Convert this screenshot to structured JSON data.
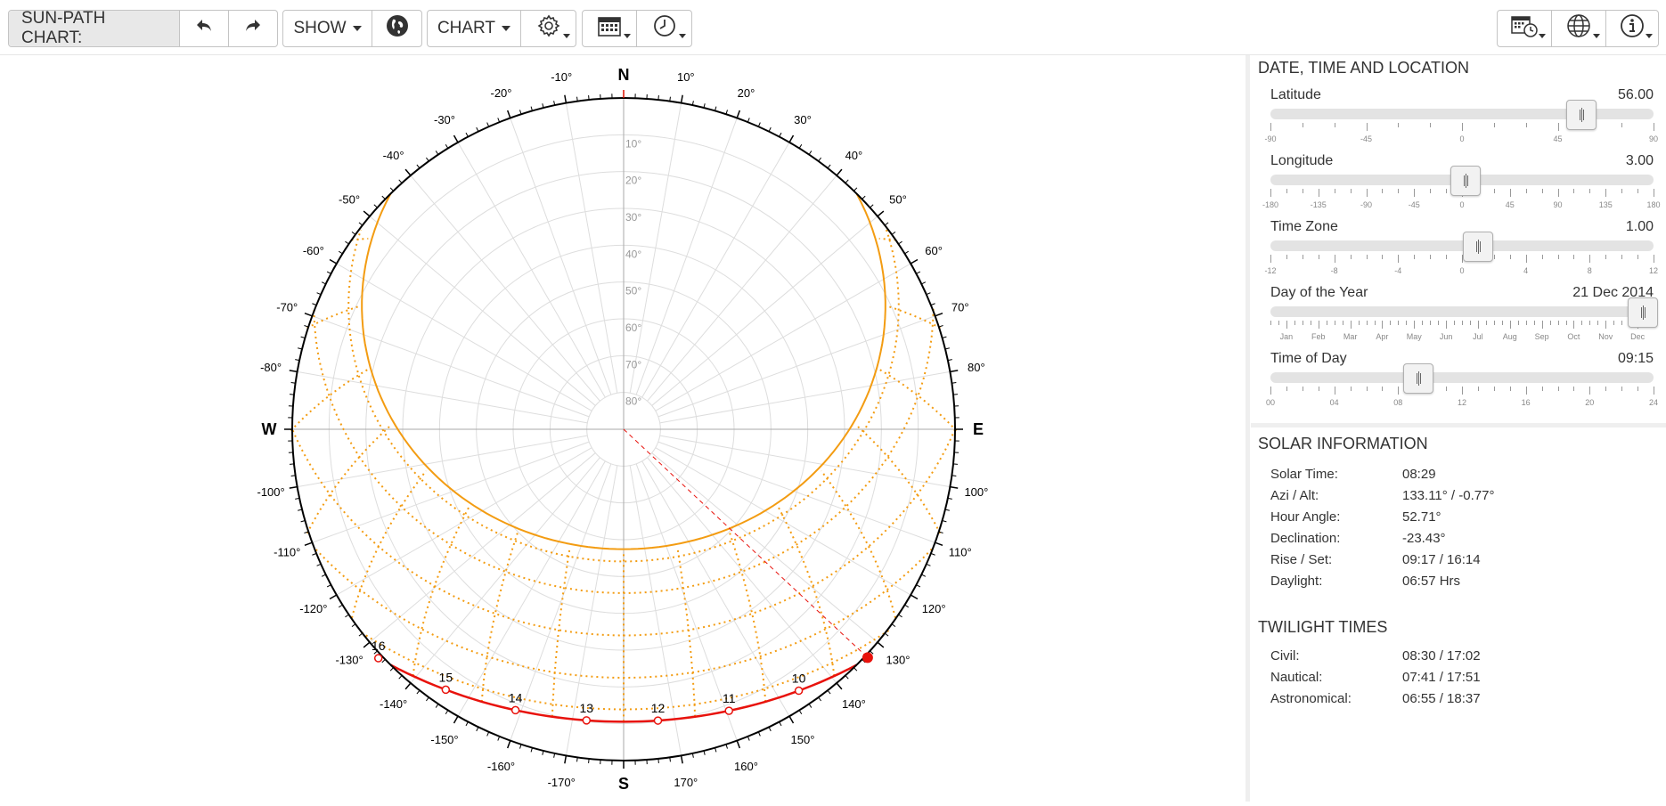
{
  "toolbar": {
    "title": "SUN-PATH CHART:",
    "undo_icon": "undo-icon",
    "redo_icon": "redo-icon",
    "show_label": "SHOW",
    "globe_icon": "globe-icon",
    "chart_label": "CHART",
    "settings_icon": "gear-icon",
    "calendar_icon": "calendar-icon",
    "clock_icon": "clock-icon",
    "date_time_icon": "calendar-clock-icon",
    "location_icon": "globe-outline-icon",
    "info_icon": "info-icon"
  },
  "location": {
    "title": "DATE, TIME AND LOCATION",
    "sliders": [
      {
        "label": "Latitude",
        "value": "56.00",
        "min": -90,
        "max": 90,
        "current": 56,
        "tick_labels": [
          {
            "v": -90,
            "t": "-90"
          },
          {
            "v": -45,
            "t": "-45"
          },
          {
            "v": 0,
            "t": "0"
          },
          {
            "v": 45,
            "t": "45"
          },
          {
            "v": 90,
            "t": "90"
          }
        ],
        "minor_step": 15
      },
      {
        "label": "Longitude",
        "value": "3.00",
        "min": -180,
        "max": 180,
        "current": 3,
        "tick_labels": [
          {
            "v": -180,
            "t": "-180"
          },
          {
            "v": -135,
            "t": "-135"
          },
          {
            "v": -90,
            "t": "-90"
          },
          {
            "v": -45,
            "t": "-45"
          },
          {
            "v": 0,
            "t": "0"
          },
          {
            "v": 45,
            "t": "45"
          },
          {
            "v": 90,
            "t": "90"
          },
          {
            "v": 135,
            "t": "135"
          },
          {
            "v": 180,
            "t": "180"
          }
        ],
        "minor_step": 15
      },
      {
        "label": "Time Zone",
        "value": "1.00",
        "min": -12,
        "max": 12,
        "current": 1,
        "tick_labels": [
          {
            "v": -12,
            "t": "-12"
          },
          {
            "v": -8,
            "t": "-8"
          },
          {
            "v": -4,
            "t": "-4"
          },
          {
            "v": 0,
            "t": "0"
          },
          {
            "v": 4,
            "t": "4"
          },
          {
            "v": 8,
            "t": "8"
          },
          {
            "v": 12,
            "t": "12"
          }
        ],
        "minor_step": 1
      },
      {
        "label": "Day of the Year",
        "value": "21 Dec 2014",
        "min": 0,
        "max": 12,
        "current": 11.67,
        "tick_labels": [
          {
            "v": 0.5,
            "t": "Jan"
          },
          {
            "v": 1.5,
            "t": "Feb"
          },
          {
            "v": 2.5,
            "t": "Mar"
          },
          {
            "v": 3.5,
            "t": "Apr"
          },
          {
            "v": 4.5,
            "t": "May"
          },
          {
            "v": 5.5,
            "t": "Jun"
          },
          {
            "v": 6.5,
            "t": "Jul"
          },
          {
            "v": 7.5,
            "t": "Aug"
          },
          {
            "v": 8.5,
            "t": "Sep"
          },
          {
            "v": 9.5,
            "t": "Oct"
          },
          {
            "v": 10.5,
            "t": "Nov"
          },
          {
            "v": 11.5,
            "t": "Dec"
          }
        ],
        "minor_step": 0.25
      },
      {
        "label": "Time of Day",
        "value": "09:15",
        "min": 0,
        "max": 24,
        "current": 9.25,
        "tick_labels": [
          {
            "v": 0,
            "t": "00"
          },
          {
            "v": 4,
            "t": "04"
          },
          {
            "v": 8,
            "t": "08"
          },
          {
            "v": 12,
            "t": "12"
          },
          {
            "v": 16,
            "t": "16"
          },
          {
            "v": 20,
            "t": "20"
          },
          {
            "v": 24,
            "t": "24"
          }
        ],
        "minor_step": 1
      }
    ]
  },
  "solar": {
    "title": "SOLAR INFORMATION",
    "rows": [
      {
        "k": "Solar Time:",
        "v": "08:29"
      },
      {
        "k": "Azi / Alt:",
        "v": "133.11° / -0.77°"
      },
      {
        "k": "Hour Angle:",
        "v": "52.71°"
      },
      {
        "k": "Declination:",
        "v": "-23.43°"
      },
      {
        "k": "Rise / Set:",
        "v": "09:17 / 16:14"
      },
      {
        "k": "Daylight:",
        "v": "06:57 Hrs"
      }
    ]
  },
  "twilight": {
    "title": "TWILIGHT TIMES",
    "rows": [
      {
        "k": "Civil:",
        "v": "08:30 / 17:02"
      },
      {
        "k": "Nautical:",
        "v": "07:41 / 17:51"
      },
      {
        "k": "Astronomical:",
        "v": "06:55 / 18:37"
      }
    ]
  },
  "chart": {
    "cardinals": {
      "N": "N",
      "E": "E",
      "S": "S",
      "W": "W"
    },
    "azimuth_labels": [
      "10°",
      "20°",
      "30°",
      "40°",
      "50°",
      "60°",
      "70°",
      "80°",
      "100°",
      "110°",
      "120°",
      "130°",
      "140°",
      "150°",
      "160°",
      "170°",
      "-170°",
      "-160°",
      "-150°",
      "-140°",
      "-130°",
      "-120°",
      "-110°",
      "-100°",
      "-80°",
      "-70°",
      "-60°",
      "-50°",
      "-40°",
      "-30°",
      "-20°",
      "-10°"
    ],
    "altitude_labels": [
      "10°",
      "20°",
      "30°",
      "40°",
      "50°",
      "60°",
      "70°",
      "80°"
    ],
    "hour_labels": [
      {
        "h": 10,
        "azi": 145.7,
        "alt": 7.1
      },
      {
        "h": 11,
        "azi": 158.8,
        "alt": 10.0
      },
      {
        "h": 12,
        "azi": 172.4,
        "alt": 10.9
      },
      {
        "h": 13,
        "azi": 186.0,
        "alt": 9.6
      },
      {
        "h": 14,
        "azi": 198.8,
        "alt": 6.3
      },
      {
        "h": 15,
        "azi": 210.8,
        "alt": 1.2
      },
      {
        "h": 16,
        "azi": 221.9,
        "alt": -5.0
      }
    ],
    "current_sun": {
      "azi": 133.11,
      "alt": -0.77
    },
    "colors": {
      "summer_path": "#f39c12",
      "current_path": "#e8120c",
      "grid": "#dddddd"
    }
  }
}
